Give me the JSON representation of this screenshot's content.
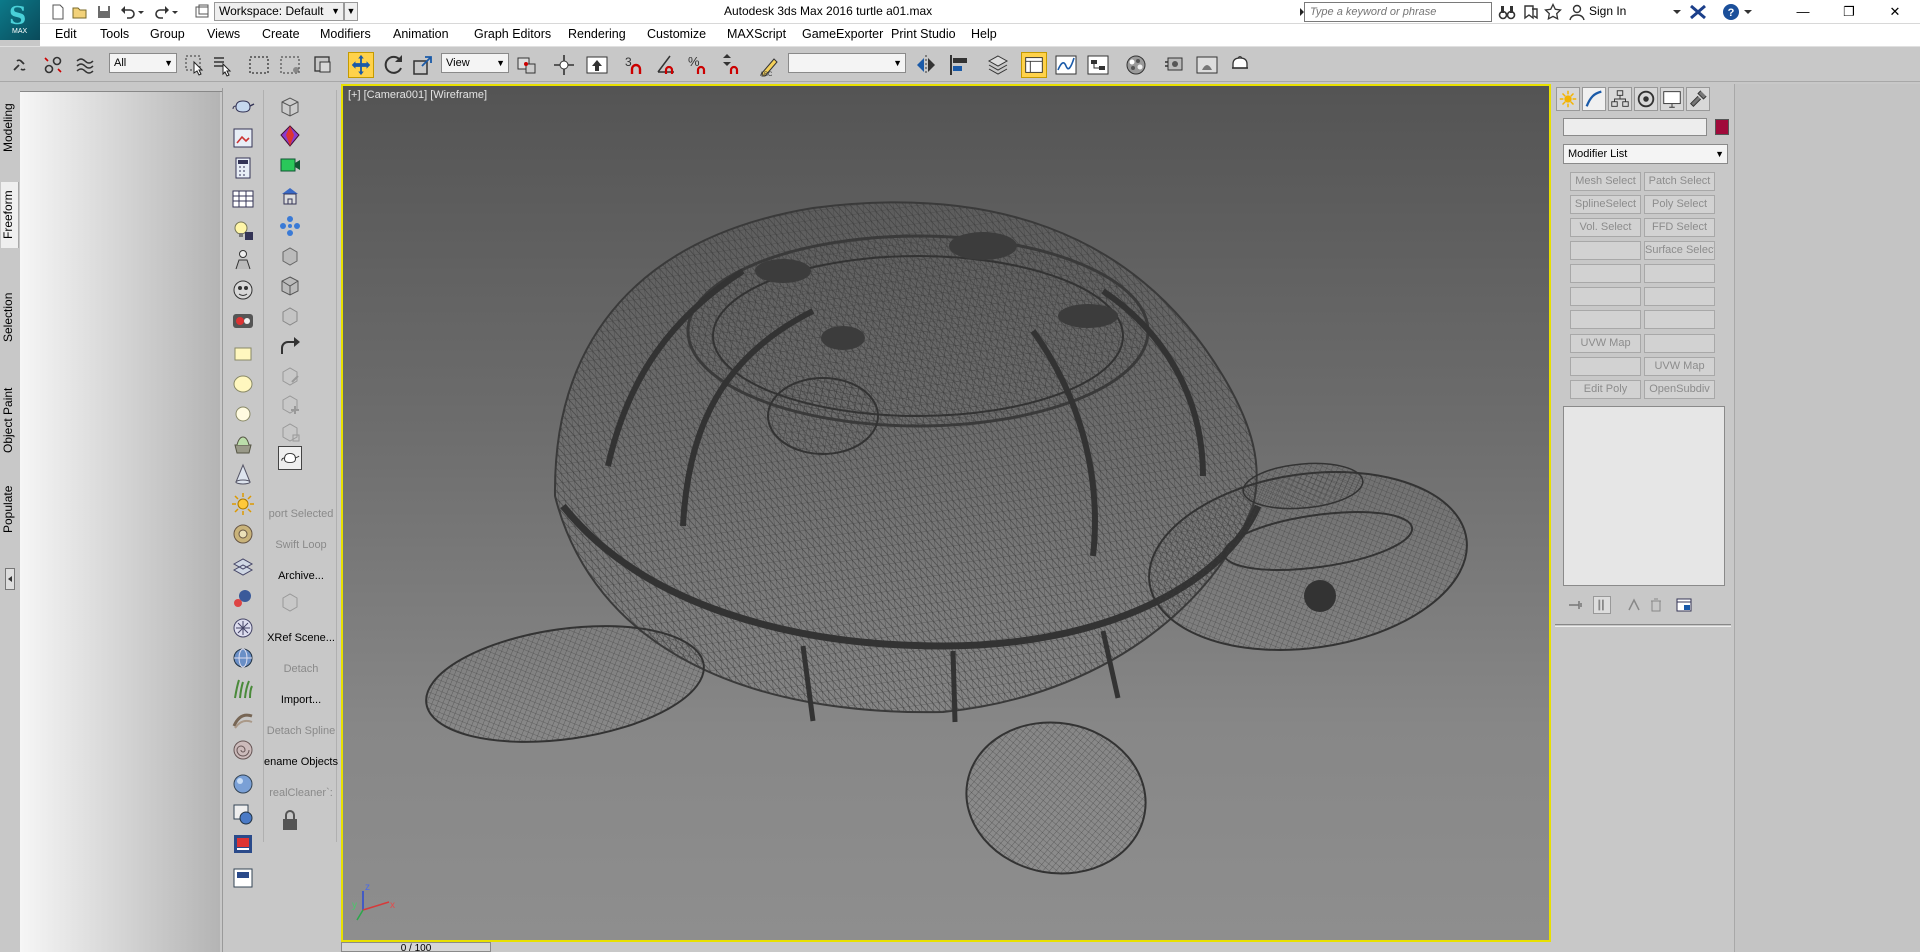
{
  "titlebar": {
    "workspace": "Workspace: Default",
    "title": "Autodesk 3ds Max 2016     turtle a01.max",
    "search_placeholder": "Type a keyword or phrase",
    "signin": "Sign In",
    "logo_text": "MAX"
  },
  "menu": [
    "Edit",
    "Tools",
    "Group",
    "Views",
    "Create",
    "Modifiers",
    "Animation",
    "Graph Editors",
    "Rendering",
    "Customize",
    "MAXScript",
    "GameExporter",
    "Print Studio",
    "Help"
  ],
  "toolbar": {
    "selection_filter": "All",
    "ref_coord": "View",
    "named_selection": ""
  },
  "ribbon_tabs": [
    "Modeling",
    "Freeform",
    "Selection",
    "Object Paint",
    "Populate"
  ],
  "command_strip": {
    "labels": [
      "port Selected",
      "Swift Loop",
      "Archive...",
      "XRef Scene...",
      "Detach",
      "Import...",
      "Detach Spline",
      "ename Objects",
      "realCleaner`:"
    ]
  },
  "viewport": {
    "label": "[+] [Camera001] [Wireframe]",
    "axis_x": "x",
    "axis_y": "y",
    "axis_z": "z"
  },
  "timebar": {
    "text": "0 / 100"
  },
  "command_panel": {
    "name_value": "",
    "modifier_list": "Modifier List",
    "buttons": [
      [
        "Mesh Select",
        "Patch Select"
      ],
      [
        "SplineSelect",
        "Poly Select"
      ],
      [
        "Vol. Select",
        "FFD Select"
      ],
      [
        "",
        "Surface Select"
      ],
      [
        "",
        ""
      ],
      [
        "",
        ""
      ],
      [
        "",
        ""
      ],
      [
        "UVW Map",
        ""
      ],
      [
        "",
        "UVW Map"
      ],
      [
        "Edit Poly",
        "OpenSubdiv"
      ]
    ],
    "swatch_color": "#a00a3a"
  },
  "colors": {
    "viewport_border": "#e8e000",
    "active_tool": "#ffd24a",
    "wireframe": "#3c3c3c"
  }
}
